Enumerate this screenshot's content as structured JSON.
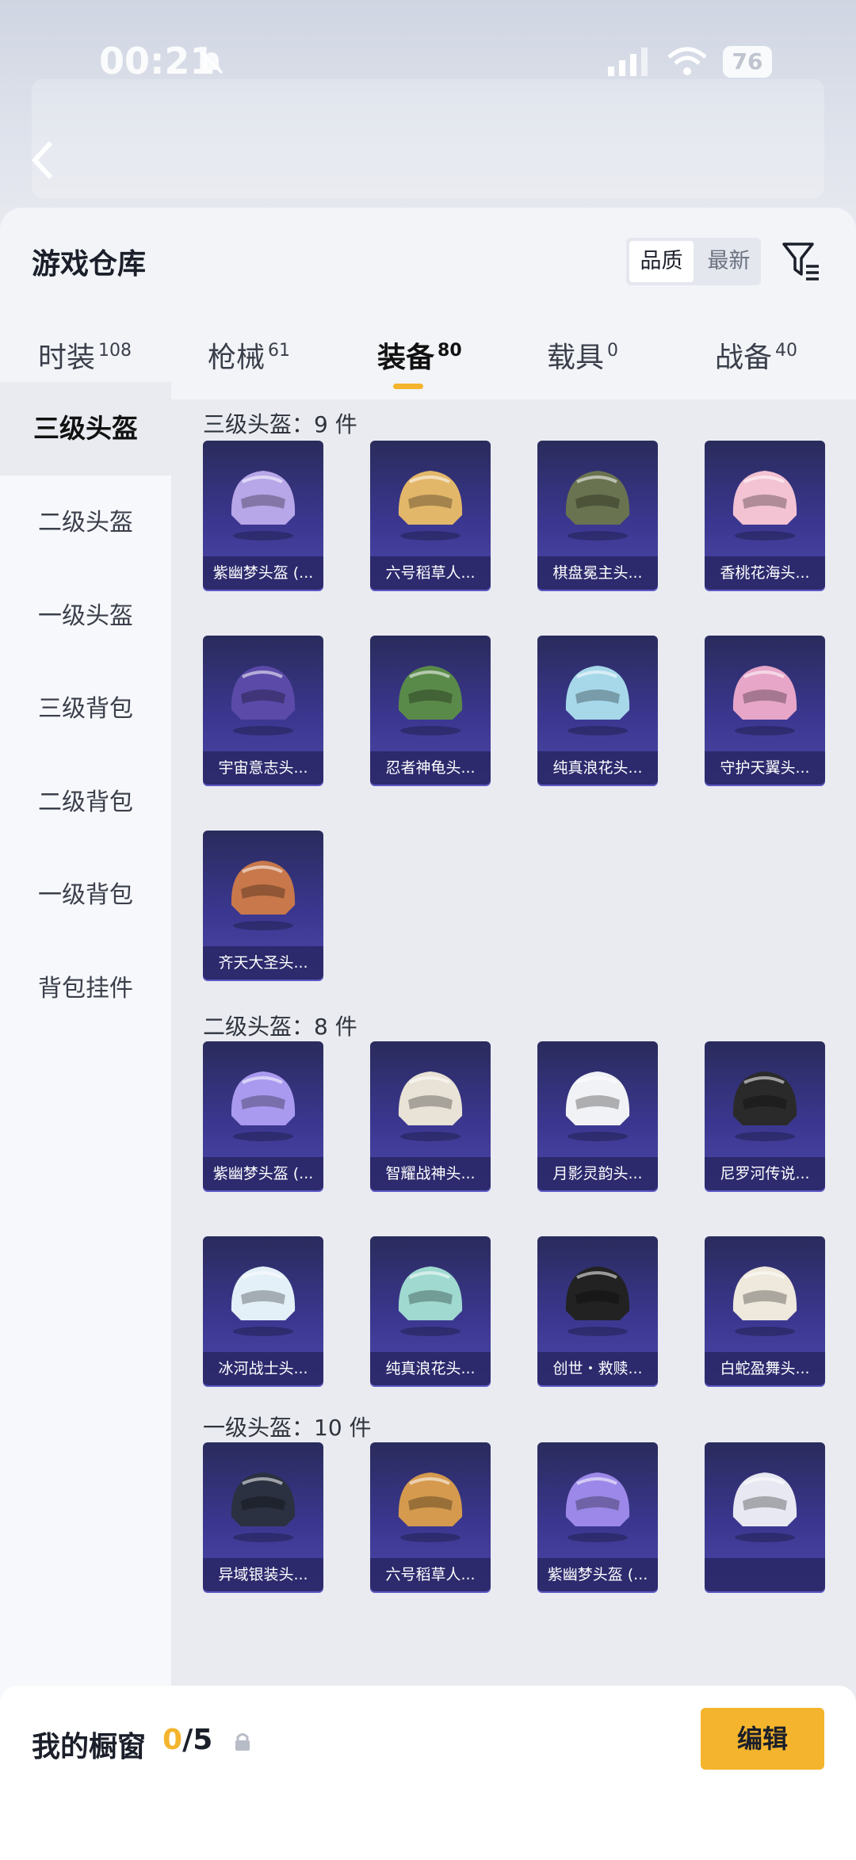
{
  "status_bar": {
    "time": "00:21",
    "battery": "76"
  },
  "header": {
    "title": "游戏仓库",
    "sort_options": [
      "品质",
      "最新"
    ]
  },
  "tabs": [
    {
      "label": "时装",
      "count": "108"
    },
    {
      "label": "枪械",
      "count": "61"
    },
    {
      "label": "装备",
      "count": "80"
    },
    {
      "label": "载具",
      "count": "0"
    },
    {
      "label": "战备",
      "count": "40"
    }
  ],
  "sidebar": [
    {
      "label": "三级头盔"
    },
    {
      "label": "二级头盔"
    },
    {
      "label": "一级头盔"
    },
    {
      "label": "三级背包"
    },
    {
      "label": "二级背包"
    },
    {
      "label": "一级背包"
    },
    {
      "label": "背包挂件"
    }
  ],
  "sections": [
    {
      "title": "三级头盔：9 件",
      "items": [
        "紫幽梦头盔 (...",
        "六号稻草人...",
        "棋盘冕主头...",
        "香桃花海头...",
        "宇宙意志头...",
        "忍者神龟头...",
        "纯真浪花头...",
        "守护天翼头...",
        "齐天大圣头..."
      ]
    },
    {
      "title": "二级头盔：8 件",
      "items": [
        "紫幽梦头盔 (...",
        "智耀战神头...",
        "月影灵韵头...",
        "尼罗河传说...",
        "冰河战士头...",
        "纯真浪花头...",
        "创世・救赎...",
        "白蛇盈舞头..."
      ]
    },
    {
      "title": "一级头盔：10 件",
      "items": [
        "异域银装头...",
        "六号稻草人...",
        "紫幽梦头盔 (...",
        ""
      ]
    }
  ],
  "bottom": {
    "label": "我的橱窗",
    "used": "0",
    "total": "/5",
    "edit_label": "编辑"
  },
  "colors": {
    "accent": "#f4b42d",
    "card_top": "#2a2b5c",
    "card_bottom": "#4c47a8"
  }
}
